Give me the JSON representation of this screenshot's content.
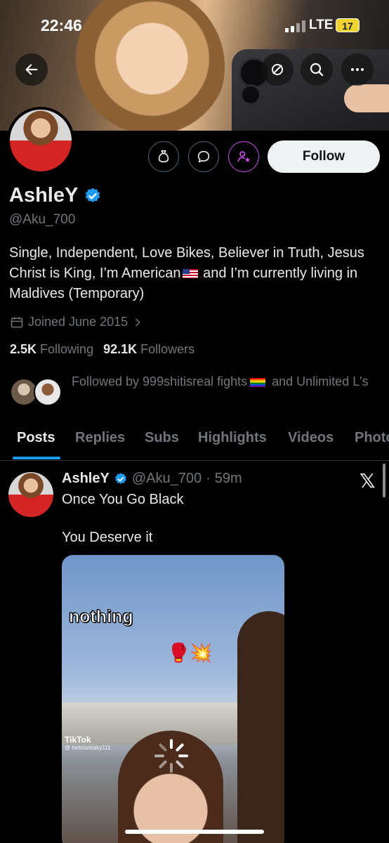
{
  "status_bar": {
    "time": "22:46",
    "network": "LTE",
    "battery": "17"
  },
  "header": {
    "back_icon": "arrow-left-icon",
    "hide_icon": "eye-slash-icon",
    "search_icon": "search-icon",
    "more_icon": "more-horizontal-icon"
  },
  "profile": {
    "name": "AshleY",
    "handle": "@Aku_700",
    "bio_part1": "Single, Independent, Love Bikes, Believer in Truth, Jesus Christ is King, I’m American",
    "bio_part2": " and I’m currently living in Maldives (Temporary)",
    "joined": "Joined June 2015",
    "following_count": "2.5K",
    "following_label": "Following",
    "followers_count": "92.1K",
    "followers_label": "Followers",
    "followed_by_prefix": "Followed by 999shitisreal fights",
    "followed_by_suffix": " and Unlimited L's",
    "follow_label": "Follow",
    "colors": {
      "verified": "#1d9bf0",
      "subscribe_ring": "#c850e8"
    }
  },
  "tabs": [
    "Posts",
    "Replies",
    "Subs",
    "Highlights",
    "Videos",
    "Photos"
  ],
  "post": {
    "name": "AshleY",
    "handle": "@Aku_700",
    "separator": "·",
    "time": "59m",
    "text_line1": "Once You Go Black",
    "text_line2": "You Deserve it",
    "media": {
      "overlay_text": "nothing",
      "emoji": "🥊💥",
      "watermark": "TikTok",
      "watermark_user": "@ hellstarbaby111"
    }
  }
}
